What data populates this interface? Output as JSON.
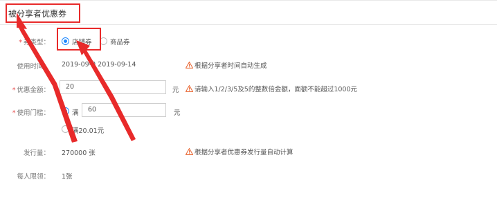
{
  "header": {
    "title": "被分享者优惠券"
  },
  "form": {
    "coupon_type": {
      "label": "券类型：",
      "options": [
        {
          "label": "店铺券",
          "selected": true
        },
        {
          "label": "商品券",
          "selected": false
        }
      ]
    },
    "use_time": {
      "label": "使用时间：",
      "value": "2019-09-0  2019-09-14",
      "note": "根据分享者时间自动生成"
    },
    "amount": {
      "label": "优惠金额：",
      "value": "20",
      "unit": "元",
      "note": "请输入1/2/3/5及5的整数倍金额，面额不能超过1000元"
    },
    "threshold": {
      "label": "使用门槛：",
      "option1_prefix": "满",
      "option1_value": "60",
      "unit": "元",
      "option2_label": "满20.01元"
    },
    "issue_qty": {
      "label": "发行量：",
      "value": "270000 张",
      "note": "根据分享者优惠券发行量自动计算"
    },
    "per_person": {
      "label": "每人限领：",
      "value": "1张"
    }
  },
  "colors": {
    "accent": "#1e88ff",
    "required": "#e84a4a",
    "warning": "#e8602a",
    "annotation": "#e82a2a"
  }
}
